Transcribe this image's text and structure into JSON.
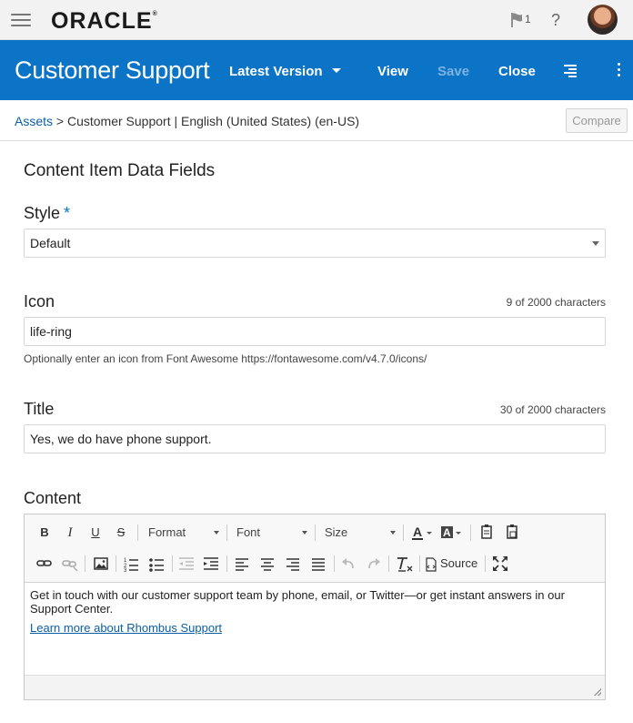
{
  "topbar": {
    "logo": "ORACLE",
    "logo_mark": "®",
    "notifications_count": "1",
    "help": "?"
  },
  "header": {
    "title": "Customer Support",
    "version": "Latest Version",
    "view": "View",
    "save": "Save",
    "close": "Close"
  },
  "breadcrumb": {
    "root": "Assets",
    "separator": ">",
    "current": "Customer Support | English (United States) (en-US)",
    "compare": "Compare"
  },
  "form": {
    "section_title": "Content Item Data Fields",
    "style": {
      "label": "Style",
      "required": "*",
      "value": "Default"
    },
    "icon": {
      "label": "Icon",
      "counter": "9 of 2000 characters",
      "value": "life-ring",
      "help": "Optionally enter an icon from Font Awesome https://fontawesome.com/v4.7.0/icons/"
    },
    "title": {
      "label": "Title",
      "counter": "30 of 2000 characters",
      "value": "Yes, we do have phone support."
    },
    "content": {
      "label": "Content",
      "toolbar": {
        "bold": "B",
        "italic": "I",
        "underline": "U",
        "strike": "S",
        "format": "Format",
        "font": "Font",
        "size": "Size",
        "source": "Source"
      },
      "text": "Get in touch with our customer support team by phone, email, or Twitter—or get instant answers in our Support Center.",
      "link": "Learn more about Rhombus Support"
    }
  },
  "colors": {
    "brand_blue": "#0b74c7",
    "link": "#0b5fa5"
  }
}
